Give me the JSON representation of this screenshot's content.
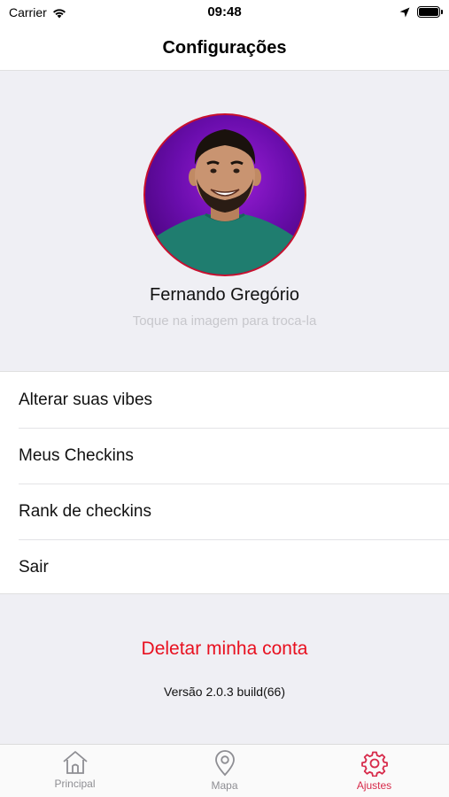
{
  "status_bar": {
    "carrier": "Carrier",
    "time": "09:48",
    "icons": [
      "wifi-icon",
      "location-arrow-icon",
      "battery-icon"
    ]
  },
  "nav": {
    "title": "Configurações"
  },
  "profile": {
    "name": "Fernando Gregório",
    "hint": "Toque na imagem para troca-la",
    "avatar_border_color": "#c8102e"
  },
  "menu": {
    "items": [
      {
        "label": "Alterar suas vibes"
      },
      {
        "label": "Meus Checkins"
      },
      {
        "label": "Rank de checkins"
      },
      {
        "label": "Sair"
      }
    ]
  },
  "footer": {
    "delete_label": "Deletar minha conta",
    "delete_color": "#e8101f",
    "version": "Versão 2.0.3 build(66)"
  },
  "tabs": [
    {
      "label": "Principal",
      "icon": "home-icon",
      "active": false
    },
    {
      "label": "Mapa",
      "icon": "map-pin-icon",
      "active": false
    },
    {
      "label": "Ajustes",
      "icon": "gear-icon",
      "active": true
    }
  ],
  "colors": {
    "accent": "#d72a4a",
    "inactive": "#8e8e93",
    "background_grouped": "#efeff4"
  }
}
